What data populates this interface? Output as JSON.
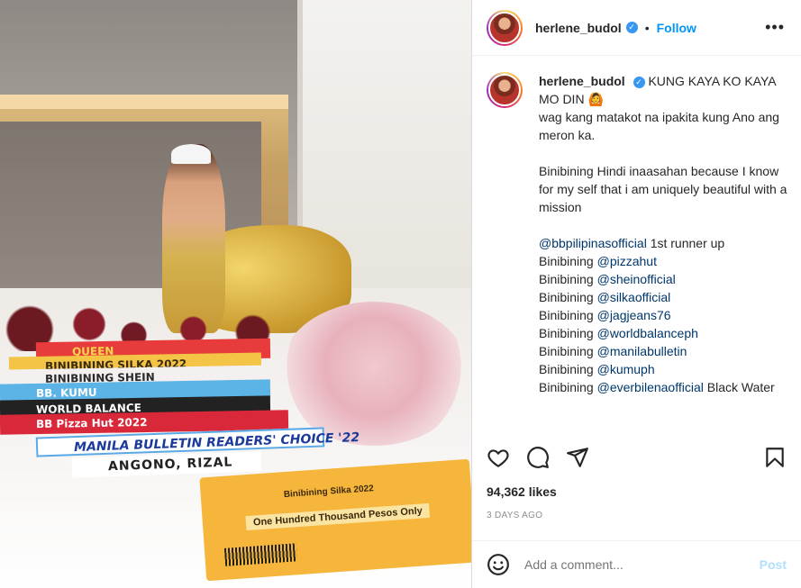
{
  "post": {
    "username": "herlene_budol",
    "dot": "•",
    "follow_label": "Follow",
    "more_label": "•••"
  },
  "photo": {
    "sashes": [
      "QUEEN",
      "BINIBINING SILKA 2022",
      "BINIBINING SHEIN",
      "BB. KUMU",
      "WORLD BALANCE",
      "BB Pizza Hut 2022",
      "MANILA BULLETIN READERS' CHOICE '22",
      "ANGONO, RIZAL"
    ],
    "cheque": {
      "pay_to": "Binibining Silka 2022",
      "amount_words": "One Hundred Thousand Pesos Only"
    }
  },
  "caption": {
    "username": "herlene_budol",
    "lines": [
      {
        "text": "KUNG KAYA KO KAYA MO DIN 🙆"
      },
      {
        "text": "wag kang matakot na ipakita kung Ano ang meron ka."
      },
      {
        "text": ""
      },
      {
        "text": "Binibining Hindi inaasahan because I know for my self that i am uniquely beautiful with a mission"
      },
      {
        "text": ""
      }
    ],
    "mention_lines": [
      {
        "prefix": "",
        "mention": "@bbpilipinasofficial",
        "suffix": " 1st runner up"
      },
      {
        "prefix": "Binibining ",
        "mention": "@pizzahut",
        "suffix": ""
      },
      {
        "prefix": "Binibining ",
        "mention": "@sheinofficial",
        "suffix": ""
      },
      {
        "prefix": "Binibining ",
        "mention": "@silkaofficial",
        "suffix": ""
      },
      {
        "prefix": "Binibining ",
        "mention": "@jagjeans76",
        "suffix": ""
      },
      {
        "prefix": "Binibining ",
        "mention": "@worldbalanceph",
        "suffix": ""
      },
      {
        "prefix": "Binibining ",
        "mention": "@manilabulletin",
        "suffix": ""
      },
      {
        "prefix": "Binibining ",
        "mention": "@kumuph",
        "suffix": ""
      },
      {
        "prefix": "Binibining ",
        "mention": "@everbilenaofficial",
        "suffix": " Black Water"
      }
    ]
  },
  "stats": {
    "likes": "94,362 likes",
    "posted_ago": "3 DAYS AGO"
  },
  "comment": {
    "placeholder": "Add a comment...",
    "post_label": "Post"
  },
  "icons": {
    "like": "heart-icon",
    "comment": "comment-bubble-icon",
    "share": "paper-plane-icon",
    "save": "bookmark-icon",
    "emoji": "smiley-icon",
    "verified": "verified-badge-icon"
  },
  "colors": {
    "accent": "#0095f6",
    "mention": "#00376b",
    "muted": "#8e8e8e",
    "verified": "#3897f0",
    "post_disabled": "#b2dffc"
  }
}
